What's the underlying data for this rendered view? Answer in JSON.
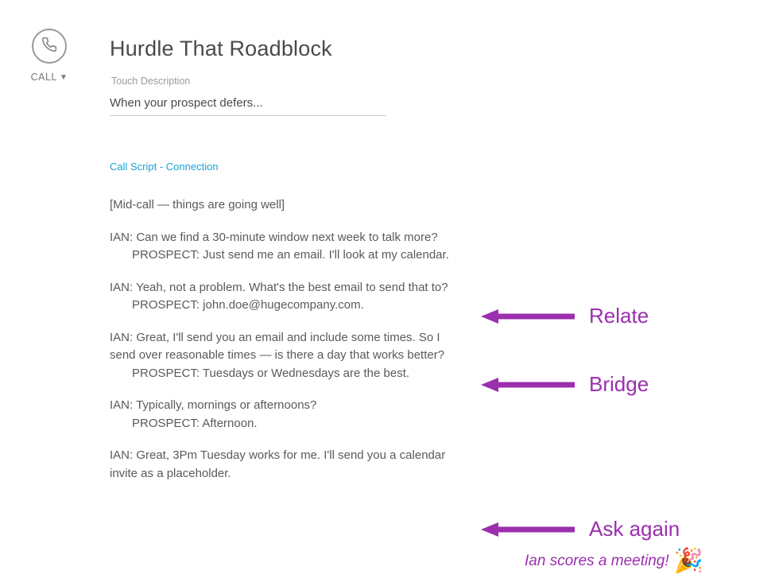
{
  "sidebar": {
    "call_label": "CALL"
  },
  "main": {
    "title": "Hurdle That Roadblock",
    "touch_label": "Touch Description",
    "touch_value": "When your prospect defers...",
    "script_link": "Call Script - Connection",
    "lines": {
      "intro": "[Mid-call — things are going well]",
      "ian1": "IAN: Can we find a 30-minute window next week to talk more?",
      "prospect1": "PROSPECT: Just send me an email. I'll look at my calendar.",
      "ian2": "IAN: Yeah, not a problem. What's the best email to send that to?",
      "prospect2": "PROSPECT: john.doe@hugecompany.com.",
      "ian3a": "IAN: Great, I'll send you an email and include some times. So I",
      "ian3b": "send over reasonable times — is there a day that works better?",
      "prospect3": "PROSPECT: Tuesdays or Wednesdays are the best.",
      "ian4": "IAN: Typically, mornings or afternoons?",
      "prospect4": "PROSPECT: Afternoon.",
      "ian5a": "IAN: Great, 3Pm Tuesday works for me. I'll send you a calendar",
      "ian5b": "invite as a placeholder."
    }
  },
  "annotations": {
    "relate": "Relate",
    "bridge": "Bridge",
    "ask_again": "Ask again",
    "subnote": "Ian scores a meeting!",
    "emoji": "🎉"
  }
}
